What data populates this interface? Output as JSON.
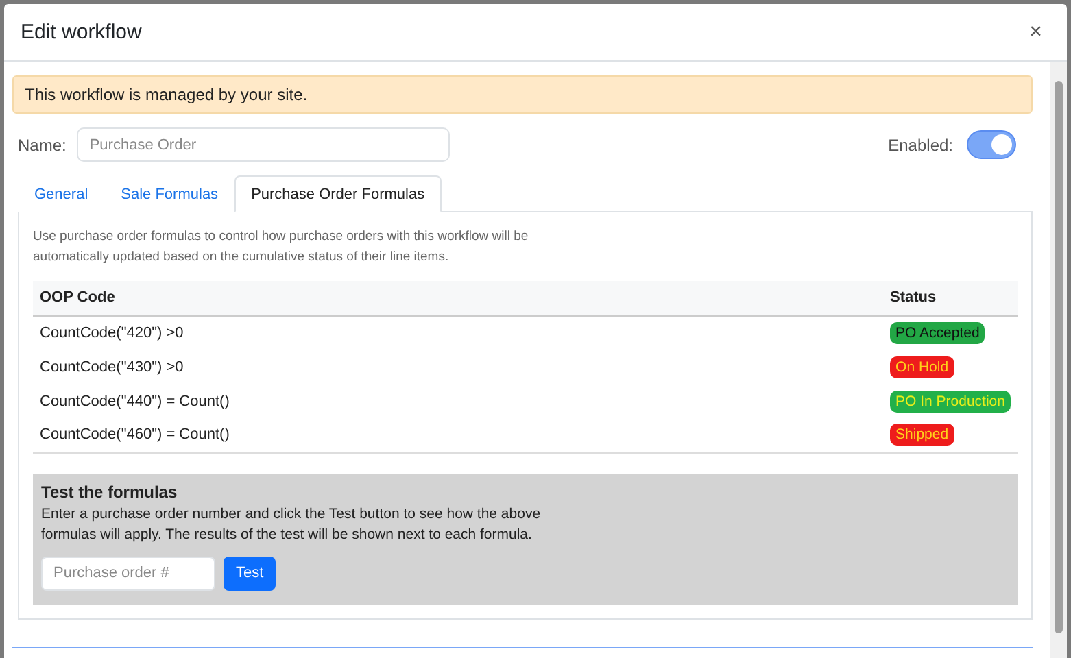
{
  "window": {
    "title": "Edit workflow",
    "close": "×"
  },
  "notice": "This workflow is managed by your site.",
  "name_field": {
    "label": "Name:",
    "placeholder": "Purchase Order"
  },
  "enabled": {
    "label": "Enabled:",
    "on": true
  },
  "tabs": [
    {
      "label": "General",
      "selected": false
    },
    {
      "label": "Sale Formulas",
      "selected": false
    },
    {
      "label": "Purchase Order Formulas",
      "selected": true
    }
  ],
  "description": "Use purchase order formulas to control how purchase orders with this workflow will be automatically updated based on the cumulative status of their line items.",
  "table": {
    "columns": [
      "OOP Code",
      "Status"
    ],
    "rows": [
      {
        "code": "CountCode(\"420\") >0",
        "status": "PO Accepted",
        "color": "#22a745"
      },
      {
        "code": "CountCode(\"430\") >0",
        "status": "On Hold",
        "color": "#ee1c1c"
      },
      {
        "code": "CountCode(\"440\") = Count()",
        "status": "PO In Production",
        "color": "#22b04a"
      },
      {
        "code": "CountCode(\"460\") = Count()",
        "status": "Shipped",
        "color": "#ee1c1c"
      }
    ]
  },
  "test": {
    "title": "Test the formulas",
    "text": "Enter a purchase order number and click the Test button to see how the above formulas will apply. The results of the test will be shown next to each formula.",
    "placeholder": "Purchase order #",
    "button": "Test"
  }
}
